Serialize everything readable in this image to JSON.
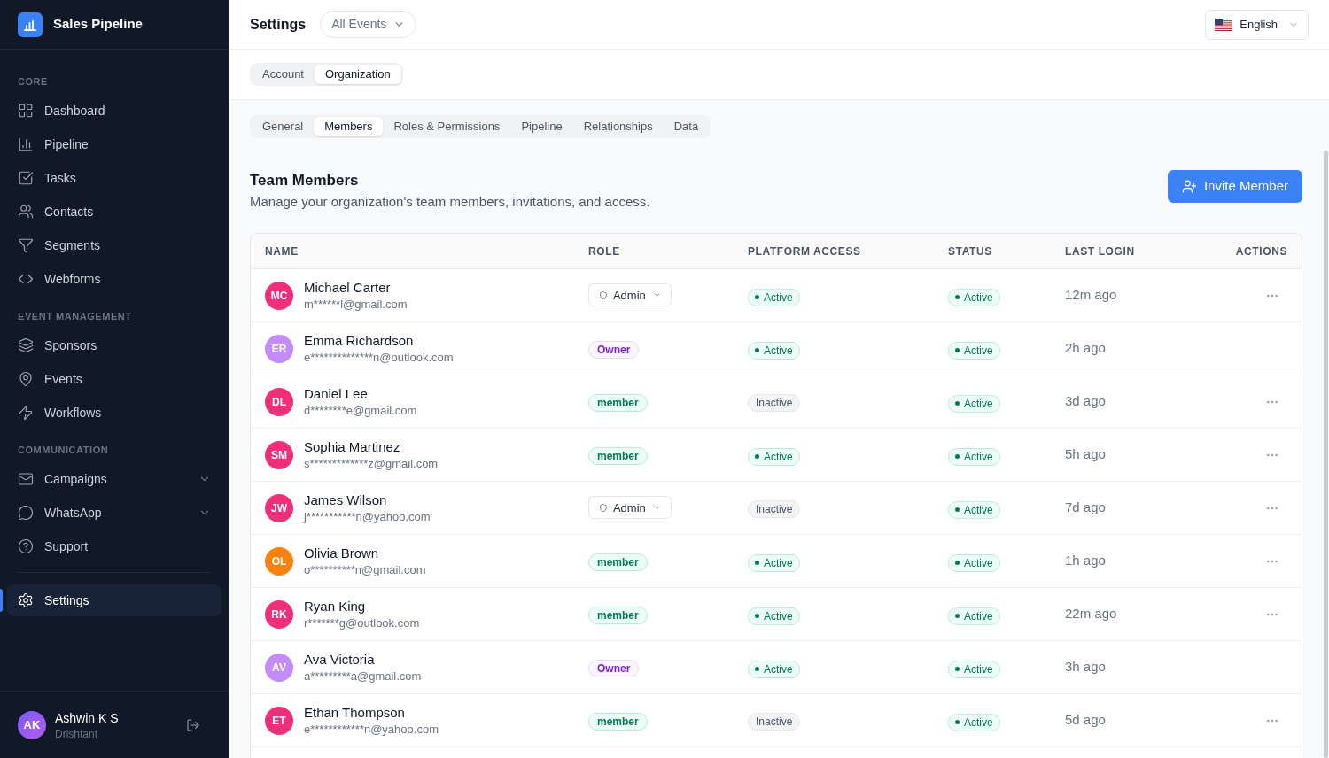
{
  "sidebar": {
    "brand": "Sales Pipeline",
    "sections": [
      {
        "title": "CORE",
        "items": [
          {
            "label": "Dashboard",
            "kind": "link",
            "selected": false
          },
          {
            "label": "Pipeline",
            "kind": "link",
            "selected": false
          },
          {
            "label": "Tasks",
            "kind": "link",
            "selected": false
          },
          {
            "label": "Contacts",
            "kind": "link",
            "selected": false
          },
          {
            "label": "Segments",
            "kind": "link",
            "selected": false
          },
          {
            "label": "Webforms",
            "kind": "link",
            "selected": false
          }
        ]
      },
      {
        "title": "EVENT MANAGEMENT",
        "items": [
          {
            "label": "Sponsors",
            "kind": "link",
            "selected": false
          },
          {
            "label": "Events",
            "kind": "link",
            "selected": false
          },
          {
            "label": "Workflows",
            "kind": "link",
            "selected": false
          }
        ]
      },
      {
        "title": "COMMUNICATION",
        "items": [
          {
            "label": "Campaigns",
            "kind": "group",
            "selected": false
          },
          {
            "label": "WhatsApp",
            "kind": "group",
            "selected": false
          },
          {
            "label": "Support",
            "kind": "link",
            "selected": false
          }
        ]
      },
      {
        "items": [
          {
            "label": "Settings",
            "kind": "link",
            "selected": true
          }
        ]
      }
    ],
    "user": {
      "initials": "AK",
      "name": "Ashwin K S",
      "subtitle": "Drishtant"
    }
  },
  "header": {
    "title": "Settings",
    "event_filter": "All Events",
    "language": "English"
  },
  "account_tabs": [
    {
      "label": "Account",
      "selected": false
    },
    {
      "label": "Organization",
      "selected": true
    }
  ],
  "organization_tabs": [
    {
      "label": "General",
      "selected": false
    },
    {
      "label": "Members",
      "selected": true
    },
    {
      "label": "Roles & Permissions",
      "selected": false
    },
    {
      "label": "Pipeline",
      "selected": false
    },
    {
      "label": "Relationships",
      "selected": false
    },
    {
      "label": "Data",
      "selected": false
    }
  ],
  "team_members": {
    "title": "Team Members",
    "description": "Manage your organization's team members, invitations, and access.",
    "invite_button": "Invite Member",
    "table": {
      "columns": [
        "NAME",
        "ROLE",
        "PLATFORM ACCESS",
        "STATUS",
        "LAST LOGIN",
        "ACTIONS"
      ],
      "rows": [
        {
          "initials": "MC",
          "color": "#ef2f7a",
          "name": "Michael Carter",
          "email": "m******l@gmail.com",
          "role": {
            "kind": "admin",
            "label": "Admin"
          },
          "platform_access": {
            "label": "Active",
            "active": true
          },
          "status": {
            "label": "Active",
            "active": true
          },
          "last_login": "12m ago",
          "actions": true
        },
        {
          "initials": "ER",
          "color": "#c48cf8",
          "name": "Emma Richardson",
          "email": "e**************n@outlook.com",
          "role": {
            "kind": "owner",
            "label": "Owner"
          },
          "platform_access": {
            "label": "Active",
            "active": true
          },
          "status": {
            "label": "Active",
            "active": true
          },
          "last_login": "2h ago",
          "actions": false
        },
        {
          "initials": "DL",
          "color": "#ef2f7a",
          "name": "Daniel Lee",
          "email": "d********e@gmail.com",
          "role": {
            "kind": "member",
            "label": "member"
          },
          "platform_access": {
            "label": "Inactive",
            "active": false
          },
          "status": {
            "label": "Active",
            "active": true
          },
          "last_login": "3d ago",
          "actions": true
        },
        {
          "initials": "SM",
          "color": "#ef2f7a",
          "name": "Sophia Martinez",
          "email": "s*************z@gmail.com",
          "role": {
            "kind": "member",
            "label": "member"
          },
          "platform_access": {
            "label": "Active",
            "active": true
          },
          "status": {
            "label": "Active",
            "active": true
          },
          "last_login": "5h ago",
          "actions": true
        },
        {
          "initials": "JW",
          "color": "#ef2f7a",
          "name": "James Wilson",
          "email": "j***********n@yahoo.com",
          "role": {
            "kind": "admin",
            "label": "Admin"
          },
          "platform_access": {
            "label": "Inactive",
            "active": false
          },
          "status": {
            "label": "Active",
            "active": true
          },
          "last_login": "7d ago",
          "actions": true
        },
        {
          "initials": "OL",
          "color": "#f7820f",
          "name": "Olivia Brown",
          "email": "o**********n@gmail.com",
          "role": {
            "kind": "member",
            "label": "member"
          },
          "platform_access": {
            "label": "Active",
            "active": true
          },
          "status": {
            "label": "Active",
            "active": true
          },
          "last_login": "1h ago",
          "actions": true
        },
        {
          "initials": "RK",
          "color": "#ef2f7a",
          "name": "Ryan King",
          "email": "r*******g@outlook.com",
          "role": {
            "kind": "member",
            "label": "member"
          },
          "platform_access": {
            "label": "Active",
            "active": true
          },
          "status": {
            "label": "Active",
            "active": true
          },
          "last_login": "22m ago",
          "actions": true
        },
        {
          "initials": "AV",
          "color": "#c48cf8",
          "name": "Ava Victoria",
          "email": "a*********a@gmail.com",
          "role": {
            "kind": "owner",
            "label": "Owner"
          },
          "platform_access": {
            "label": "Active",
            "active": true
          },
          "status": {
            "label": "Active",
            "active": true
          },
          "last_login": "3h ago",
          "actions": false
        },
        {
          "initials": "ET",
          "color": "#ef2f7a",
          "name": "Ethan Thompson",
          "email": "e************n@yahoo.com",
          "role": {
            "kind": "member",
            "label": "member"
          },
          "platform_access": {
            "label": "Inactive",
            "active": false
          },
          "status": {
            "label": "Active",
            "active": true
          },
          "last_login": "5d ago",
          "actions": true
        }
      ]
    }
  }
}
